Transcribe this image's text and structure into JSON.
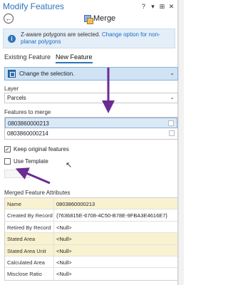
{
  "window": {
    "title": "Modify Features",
    "controls": [
      "?",
      "▾",
      "⊞",
      "✕"
    ]
  },
  "tool": {
    "name": "Merge"
  },
  "info": {
    "text": "Z-aware polygons are selected.",
    "link": "Change option for non-planar polygons"
  },
  "tabs": [
    {
      "label": "Existing Feature"
    },
    {
      "label": "New Feature"
    }
  ],
  "selection": {
    "label": "Change the selection."
  },
  "layer": {
    "label": "Layer",
    "value": "Parcels"
  },
  "features": {
    "label": "Features to merge",
    "items": [
      "0803860000213",
      "0803860000214"
    ]
  },
  "options": {
    "keep_original": "Keep original features",
    "use_template": "Use Template",
    "keep_checked": "✓"
  },
  "attributes": {
    "label": "Merged Feature Attributes",
    "rows": [
      {
        "name": "Name",
        "value": "0803860000213"
      },
      {
        "name": "Created By Record",
        "value": "{7636815E-6708-4C50-B78E-9FBA3E4616E7}"
      },
      {
        "name": "Retired By Record",
        "value": "<Null>"
      },
      {
        "name": "Stated Area",
        "value": "<Null>"
      },
      {
        "name": "Stated Area Unit",
        "value": "<Null>"
      },
      {
        "name": "Calculated Area",
        "value": "<Null>"
      },
      {
        "name": "Misclose Ratio",
        "value": "<Null>"
      }
    ]
  },
  "colors": {
    "accent": "#2e75b6",
    "annotation_arrow": "#6a2c91",
    "highlight_row": "#f9f2d1"
  }
}
